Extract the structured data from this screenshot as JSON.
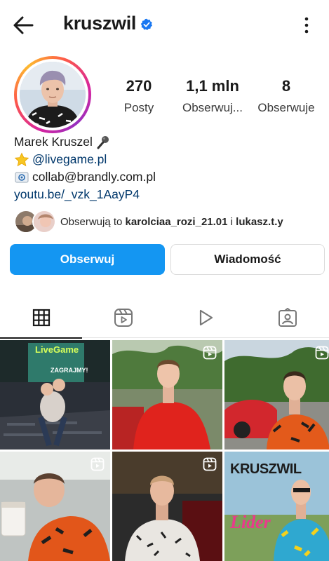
{
  "header": {
    "username": "kruszwil",
    "verified": true,
    "back_icon": "arrow-left-icon",
    "more_icon": "vertical-dots-icon"
  },
  "stats": {
    "posts": {
      "value": "270",
      "label": "Posty"
    },
    "followers": {
      "value": "1,1 mln",
      "label": "Obserwuj..."
    },
    "following": {
      "value": "8",
      "label": "Obserwuje"
    }
  },
  "bio": {
    "name": "Marek Kruszel",
    "name_emoji": "microphone-icon",
    "line1_link": "@livegame.pl",
    "line2_text": "collab@brandly.com.pl",
    "url": "youtu.be/_vzk_1AayP4"
  },
  "followed_by": {
    "prefix": "Obserwują to",
    "user1": "karolciaa_rozi_21.01",
    "joiner": "i",
    "user2": "lukasz.t.y"
  },
  "actions": {
    "follow": "Obserwuj",
    "message": "Wiadomość"
  },
  "tabs": [
    {
      "icon": "grid-icon",
      "active": true
    },
    {
      "icon": "reels-icon",
      "active": false
    },
    {
      "icon": "play-icon",
      "active": false
    },
    {
      "icon": "tagged-icon",
      "active": false
    }
  ],
  "grid_posts": [
    {
      "label": "LiveGame",
      "sub": "ZAGRAJMY!",
      "type": "post"
    },
    {
      "label": "",
      "type": "reel"
    },
    {
      "label": "",
      "type": "reel"
    },
    {
      "label": "",
      "type": "reel"
    },
    {
      "label": "",
      "type": "reel"
    },
    {
      "label": "KRUSZWIL",
      "sub": "Lider",
      "type": "post"
    }
  ],
  "colors": {
    "primary_button": "#1496f2",
    "link": "#00376b",
    "verified_badge": "#1877f2"
  }
}
